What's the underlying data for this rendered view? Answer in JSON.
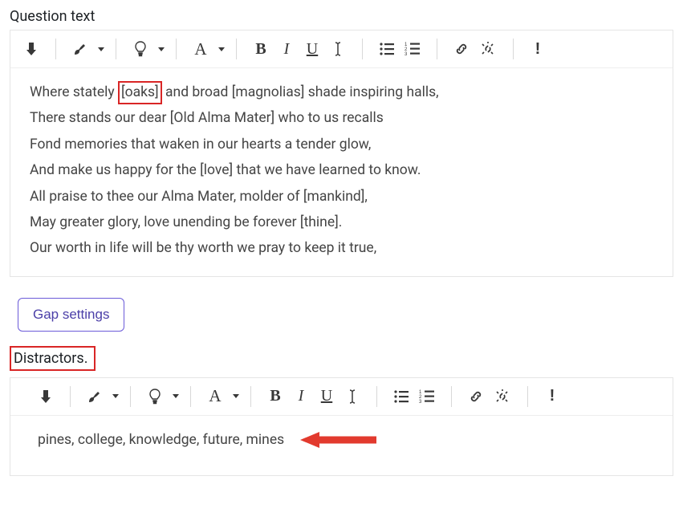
{
  "question": {
    "label": "Question text",
    "content": {
      "prefix1": "Where stately ",
      "highlighted": "[oaks]",
      "suffix1": " and broad [magnolias] shade inspiring halls,",
      "line2": "There stands our dear [Old Alma Mater] who to us recalls",
      "line3": "Fond memories that waken in our hearts a tender glow,",
      "line4": "And make us happy for the [love] that we have learned to know.",
      "line5": "All praise to thee our Alma Mater, molder of [mankind],",
      "line6": "May greater glory, love unending be forever [thine].",
      "line7": "Our worth in life will be thy worth we pray to keep it true,"
    }
  },
  "gap_settings_label": "Gap settings",
  "distractors": {
    "label": "Distractors.",
    "content": "pines, college, knowledge, future, mines"
  },
  "toolbar": {
    "font_letter": "A",
    "bold": "B",
    "italic": "I",
    "underline": "U",
    "warning": "!"
  }
}
